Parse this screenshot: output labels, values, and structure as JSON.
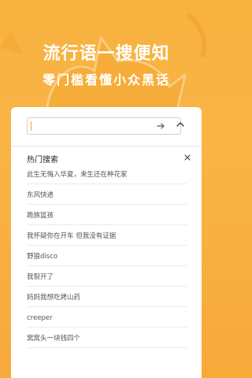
{
  "hero": {
    "title": "流行语一搜便知",
    "subtitle": "零门槛看懂小众黑话"
  },
  "search": {
    "value": "",
    "placeholder": "",
    "submit_icon": "arrow-right-icon",
    "collapse_icon": "chevron-up-icon"
  },
  "hot": {
    "title": "热门搜索",
    "close_icon": "close-icon",
    "items": [
      {
        "label": "此生无悔入华夏，来生还在种花家"
      },
      {
        "label": "东风快递"
      },
      {
        "label": "跪族篮孩"
      },
      {
        "label": "我怀疑你在开车 但我没有证据"
      },
      {
        "label": "野狼disco"
      },
      {
        "label": "我裂开了"
      },
      {
        "label": "妈妈我想吃烤山药"
      },
      {
        "label": "creeper"
      },
      {
        "label": "窝窝头一块钱四个"
      }
    ]
  },
  "colors": {
    "background": "#f7b23f",
    "accent": "#f0a32e",
    "card": "#ffffff"
  }
}
